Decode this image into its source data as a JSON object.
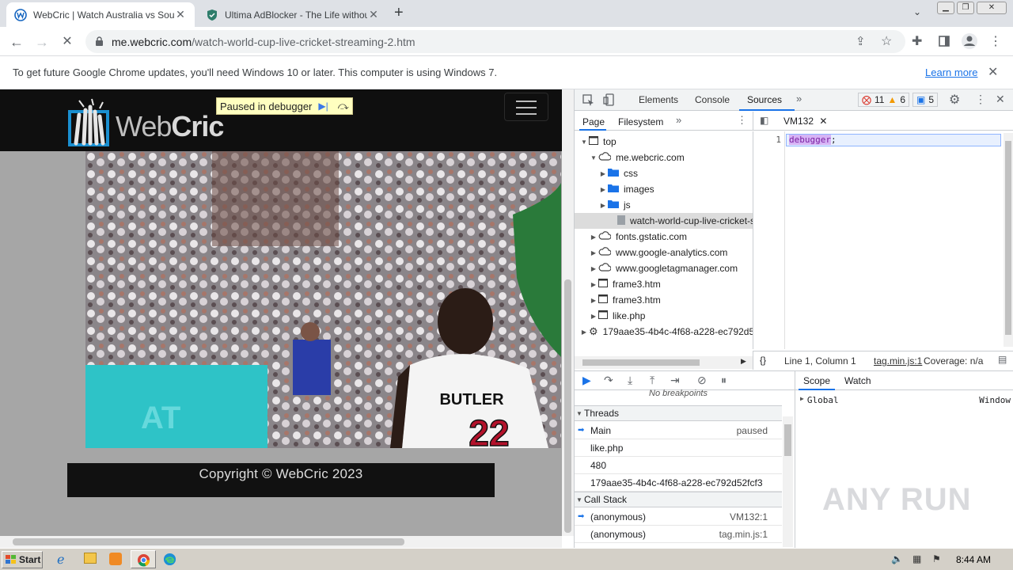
{
  "browser": {
    "tabs": [
      {
        "title": "WebCric | Watch Australia vs South",
        "active": true
      },
      {
        "title": "Ultima AdBlocker - The Life without A",
        "active": false
      }
    ],
    "url_host": "me.webcric.com",
    "url_path": "/watch-world-cup-live-cricket-streaming-2.htm",
    "infobar": {
      "text": "To get future Google Chrome updates, you'll need Windows 10 or later. This computer is using Windows 7.",
      "link": "Learn more"
    }
  },
  "page": {
    "logo_text_a": "Web",
    "logo_text_b": "Cric",
    "paused_label": "Paused in debugger",
    "video_jersey_name": "BUTLER",
    "video_jersey_number": "22",
    "footer_copyright": "Copyright © WebCric 2023"
  },
  "devtools": {
    "tabs": [
      "Elements",
      "Console",
      "Sources"
    ],
    "selected_tab": "Sources",
    "errors": "11",
    "warnings": "6",
    "messages": "5",
    "navigator_tabs": [
      "Page",
      "Filesystem"
    ],
    "tree": [
      {
        "label": "top",
        "depth": 0,
        "icon": "frame",
        "open": true
      },
      {
        "label": "me.webcric.com",
        "depth": 1,
        "icon": "cloud",
        "open": true
      },
      {
        "label": "css",
        "depth": 2,
        "icon": "folder",
        "open": false
      },
      {
        "label": "images",
        "depth": 2,
        "icon": "folder",
        "open": false
      },
      {
        "label": "js",
        "depth": 2,
        "icon": "folder",
        "open": false
      },
      {
        "label": "watch-world-cup-live-cricket-st",
        "depth": 3,
        "icon": "file",
        "selected": true
      },
      {
        "label": "fonts.gstatic.com",
        "depth": 1,
        "icon": "cloud",
        "open": false
      },
      {
        "label": "www.google-analytics.com",
        "depth": 1,
        "icon": "cloud",
        "open": false
      },
      {
        "label": "www.googletagmanager.com",
        "depth": 1,
        "icon": "cloud",
        "open": false
      },
      {
        "label": "frame3.htm",
        "depth": 1,
        "icon": "frame",
        "open": false
      },
      {
        "label": "frame3.htm",
        "depth": 1,
        "icon": "frame",
        "open": false
      },
      {
        "label": "like.php",
        "depth": 1,
        "icon": "frame",
        "open": false
      },
      {
        "label": "179aae35-4b4c-4f68-a228-ec792d5",
        "depth": 0,
        "icon": "gear",
        "open": false
      }
    ],
    "editor_tab": "VM132",
    "line_number": "1",
    "code_keyword": "debugger",
    "code_rest": ";",
    "status_position": "Line 1, Column 1",
    "status_source": "tag.min.js:1",
    "status_coverage": "Coverage: n/a",
    "no_breakpoints": "No breakpoints",
    "threads_label": "Threads",
    "threads": [
      {
        "name": "Main",
        "status": "paused",
        "current": true
      },
      {
        "name": "like.php",
        "status": ""
      },
      {
        "name": "480",
        "status": ""
      },
      {
        "name": "179aae35-4b4c-4f68-a228-ec792d52fcf3",
        "status": ""
      }
    ],
    "callstack_label": "Call Stack",
    "callstack": [
      {
        "name": "(anonymous)",
        "loc": "VM132:1",
        "current": true
      },
      {
        "name": "(anonymous)",
        "loc": "tag.min.js:1"
      }
    ],
    "scope_tabs": [
      "Scope",
      "Watch"
    ],
    "scope_global": "Global",
    "scope_global_value": "Window"
  },
  "taskbar": {
    "start": "Start",
    "clock": "8:44 AM"
  },
  "watermark": "ANY RUN"
}
